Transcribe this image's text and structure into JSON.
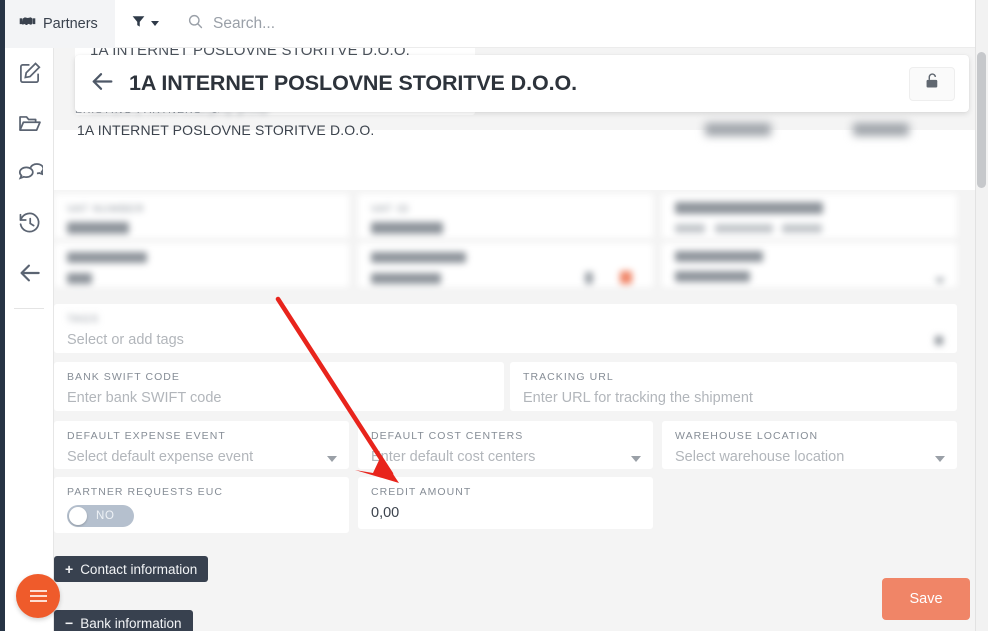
{
  "topbar": {
    "module_label": "Partners",
    "module_icon": "handshake-icon",
    "filter_icon": "funnel-icon",
    "search_icon": "search-icon",
    "search_placeholder": "Search..."
  },
  "sidebar": {
    "items": [
      {
        "icon": "edit-pencil-icon",
        "name": "edit"
      },
      {
        "icon": "folder-open-icon",
        "name": "documents"
      },
      {
        "icon": "comments-icon",
        "name": "comments"
      },
      {
        "icon": "history-clock-icon",
        "name": "history"
      },
      {
        "icon": "back-arrow-icon",
        "name": "back"
      }
    ]
  },
  "header": {
    "back_icon": "arrow-left-icon",
    "title": "1A INTERNET POSLOVNE STORITVE D.O.O.",
    "lock_icon": "unlock-icon"
  },
  "background": {
    "company_name": "1A INTERNET POSLOVNE STORITVE D.O.O."
  },
  "existing_partners": {
    "label": "EXISTING PARTNERS",
    "refresh_icon": "refresh-icon",
    "row_value": "1A INTERNET POSLOVNE STORITVE D.O.O."
  },
  "fields": {
    "vat_number": {
      "label": "VAT NUMBER",
      "value": ""
    },
    "vat_id": {
      "label": "VAT ID",
      "value": ""
    },
    "tags": {
      "label": "TAGS",
      "placeholder": "Select or add tags"
    },
    "bank_swift_code": {
      "label": "BANK SWIFT CODE",
      "placeholder": "Enter bank SWIFT code"
    },
    "tracking_url": {
      "label": "TRACKING URL",
      "placeholder": "Enter URL for tracking the shipment"
    },
    "default_expense_event": {
      "label": "DEFAULT EXPENSE EVENT",
      "placeholder": "Select default expense event"
    },
    "default_cost_centers": {
      "label": "DEFAULT COST CENTERS",
      "placeholder": "Enter default cost centers"
    },
    "warehouse_location": {
      "label": "WAREHOUSE LOCATION",
      "placeholder": "Select warehouse location"
    },
    "partner_requests_euc": {
      "label": "PARTNER REQUESTS EUC",
      "toggle_state": "NO"
    },
    "credit_amount": {
      "label": "CREDIT AMOUNT",
      "value": "0,00"
    }
  },
  "sections": {
    "contact_information": {
      "label": "Contact information",
      "sign": "+"
    },
    "bank_information": {
      "label": "Bank information",
      "sign": "−"
    }
  },
  "actions": {
    "save_label": "Save",
    "fab_icon": "menu-hamburger-icon"
  },
  "annotation": {
    "arrow_color": "#e8241c",
    "points_at": "CREDIT AMOUNT"
  },
  "colors": {
    "accent_orange": "#ef5b2b",
    "save_orange": "#f08567",
    "dark_navy": "#273445",
    "section_btn": "#38414f",
    "page_bg": "#f4f4f4"
  }
}
